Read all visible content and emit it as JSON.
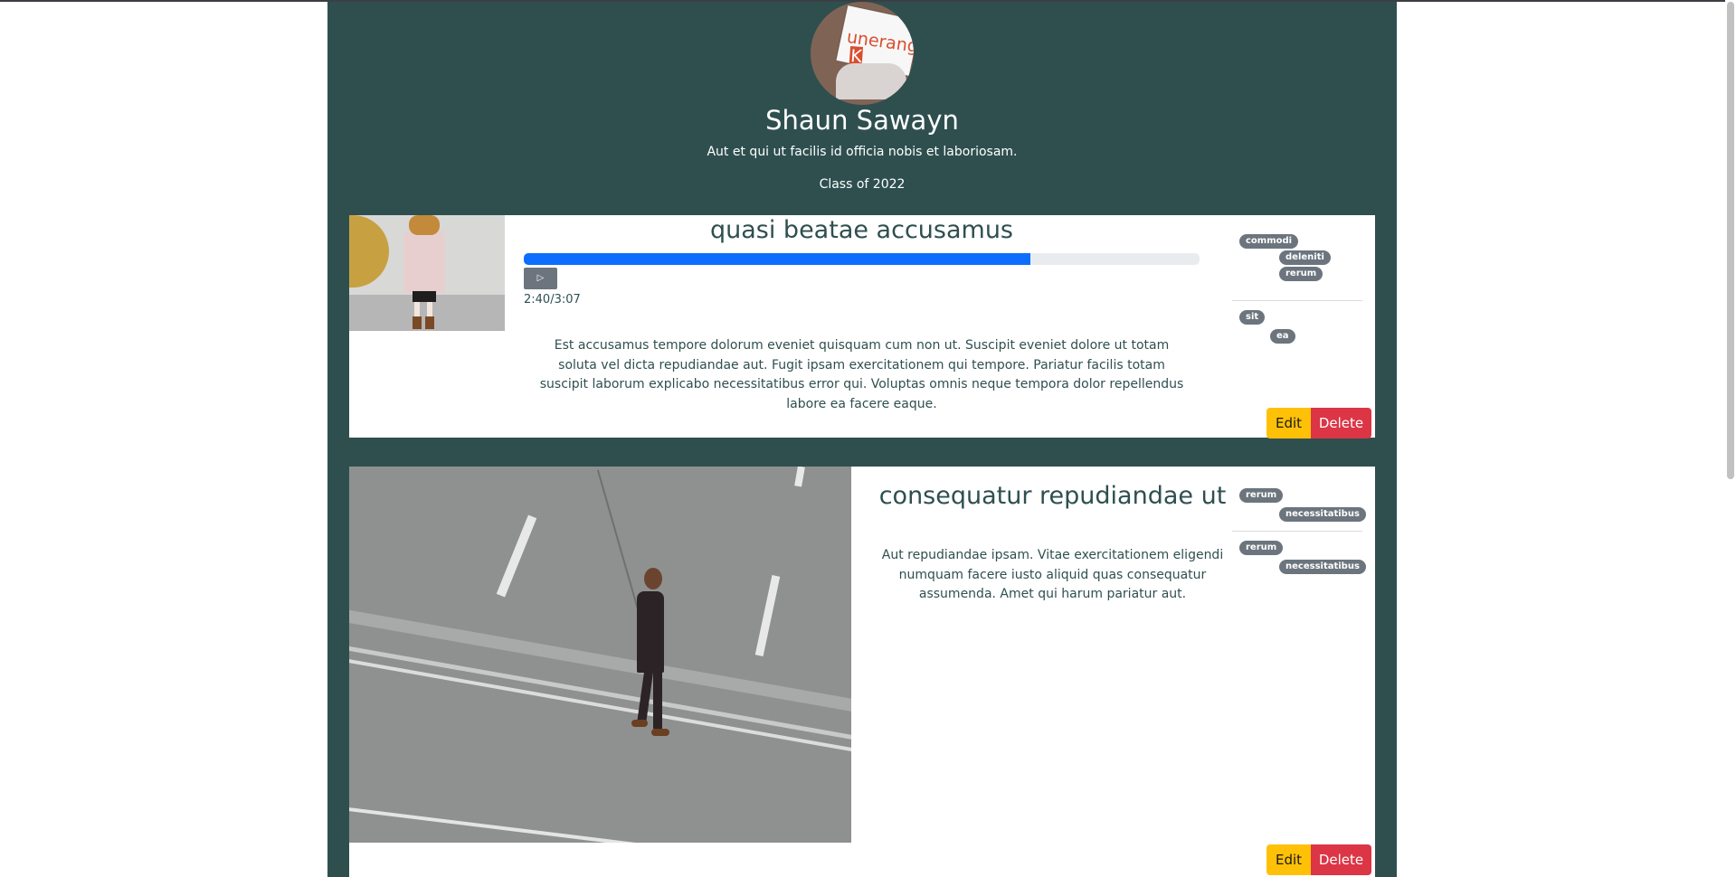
{
  "profile": {
    "name": "Shaun Sawayn",
    "bio": "Aut et qui ut facilis id officia nobis et laboriosam.",
    "class_label": "Class of 2022",
    "avatar_sign_text": "unerango",
    "avatar_sign_letter": "K"
  },
  "posts": [
    {
      "title": "quasi beatae accusamus",
      "audio": {
        "progress_fraction": 0.75,
        "time_text": "2:40/3:07",
        "play_icon": "play-icon"
      },
      "description": "Est accusamus tempore dolorum eveniet quisquam cum non ut. Suscipit eveniet dolore ut totam soluta vel dicta repudiandae aut. Fugit ipsam exercitationem qui tempore. Pariatur facilis totam suscipit laborum explicabo necessitatibus error qui. Voluptas omnis neque tempora dolor repellendus labore ea facere eaque.",
      "tag_groups": [
        [
          "commodi",
          "deleniti",
          "rerum"
        ],
        [
          "sit",
          "ea"
        ]
      ],
      "edit_label": "Edit",
      "delete_label": "Delete"
    },
    {
      "title": "consequatur repudiandae ut",
      "description": "Aut repudiandae ipsam. Vitae exercitationem eligendi numquam facere iusto aliquid quas consequatur assumenda. Amet qui harum pariatur aut.",
      "tag_groups": [
        [
          "rerum",
          "necessitatibus"
        ],
        [
          "rerum",
          "necessitatibus"
        ]
      ],
      "edit_label": "Edit",
      "delete_label": "Delete"
    }
  ],
  "colors": {
    "page_background": "#2f4f4f",
    "card_background": "#ffffff",
    "progress_fill": "#0d6efd",
    "edit_button": "#ffc107",
    "delete_button": "#dc3545",
    "tag_background": "#6c757d"
  }
}
